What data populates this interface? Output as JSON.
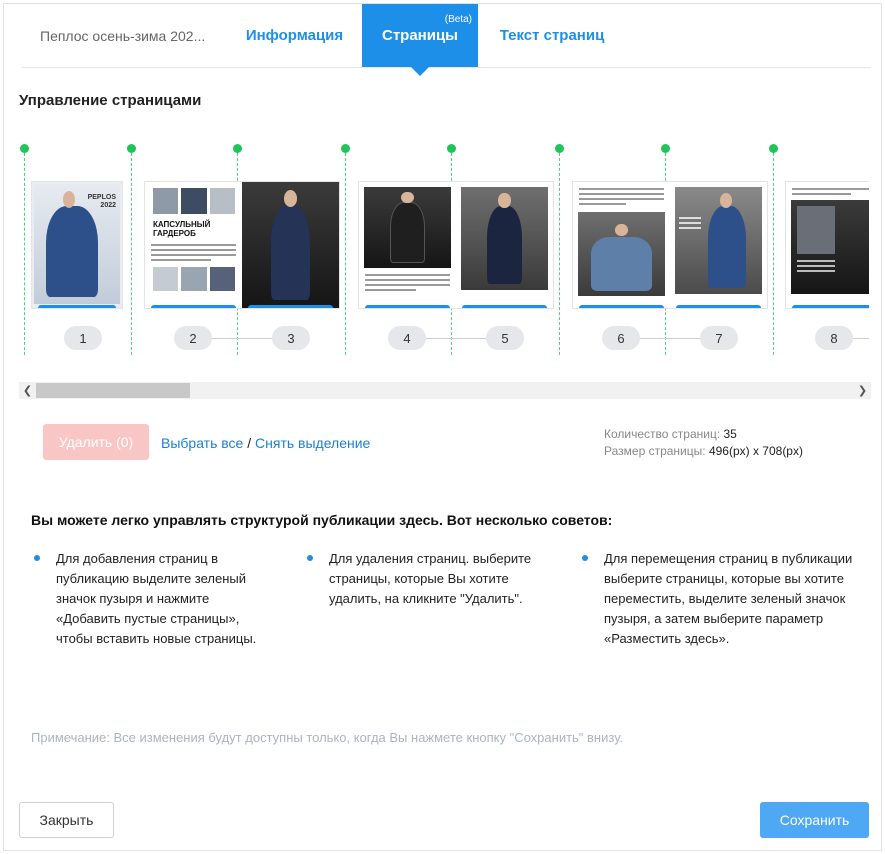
{
  "tabs": {
    "doc_title": "Пеплос осень-зима 202...",
    "info": "Информация",
    "pages": "Страницы",
    "pages_badge": "(Beta)",
    "text": "Текст страниц"
  },
  "section_title": "Управление страницами",
  "pages": {
    "numbers": [
      "1",
      "2",
      "3",
      "4",
      "5",
      "6",
      "7",
      "8"
    ],
    "cover_logo": "PEPLOS",
    "cover_year": "2022",
    "spread2_heading": "КАПСУЛЬНЫЙ ГАРДЕРОБ"
  },
  "actions": {
    "delete_label": "Удалить (0)",
    "select_all": "Выбрать все",
    "separator": "/",
    "deselect": "Снять выделение"
  },
  "stats": {
    "count_label": "Количество страниц:",
    "count_value": "35",
    "size_label": "Размер страницы:",
    "size_value": "496(px) x 708(px)"
  },
  "tips": {
    "title": "Вы можете легко управлять структурой публикации здесь. Вот несколько советов:",
    "items": [
      "Для добавления страниц в публикацию выделите зеленый значок пузыря и нажмите «Добавить пустые страницы», чтобы вставить новые страницы.",
      "Для удаления страниц. выберите страницы, которые Вы хотите удалить, на кликните \"Удалить\".",
      "Для перемещения страниц в публикации выберите страницы, которые вы хотите переместить, выделите зеленый значок пузыря, а затем выберите параметр «Разместить здесь»."
    ]
  },
  "note": "Примечание: Все изменения будут доступны только, когда Вы нажмете кнопку \"Сохранить\" внизу.",
  "footer": {
    "close_label": "Закрыть",
    "save_label": "Сохранить"
  },
  "colors": {
    "accent": "#1e8fe8",
    "insert_marker": "#1fc55a",
    "delete_disabled": "#f9c6c6",
    "save": "#4ea8f3"
  }
}
